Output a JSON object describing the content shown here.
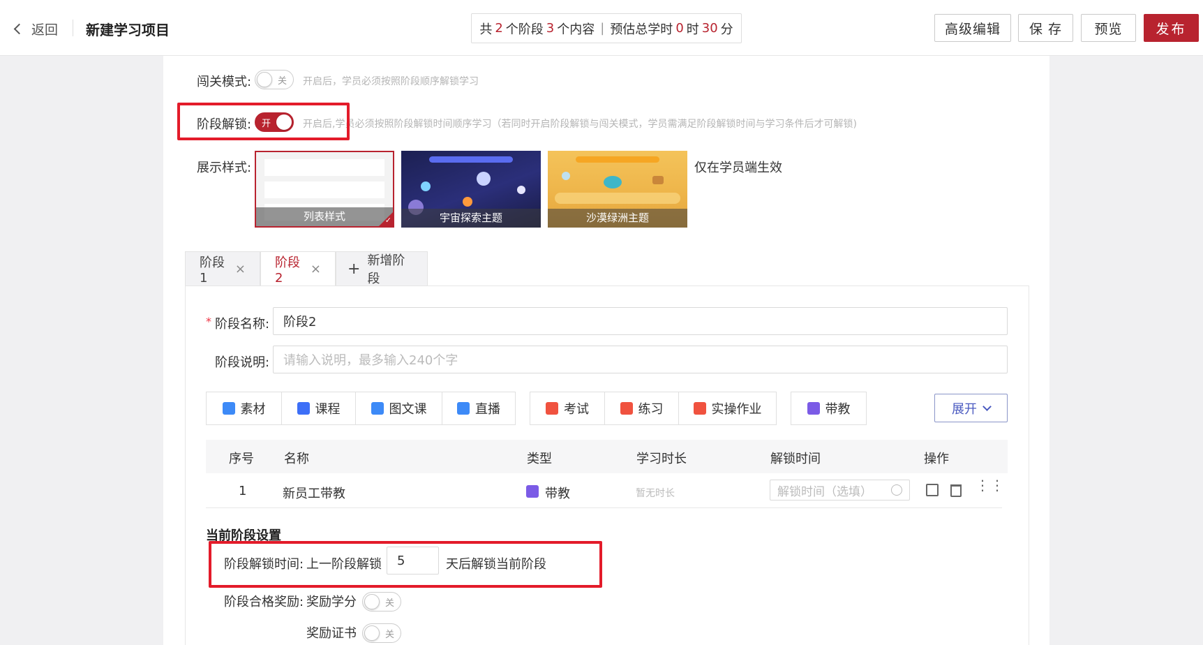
{
  "header": {
    "back_label": "返回",
    "title": "新建学习项目",
    "summary": {
      "prefix": "共",
      "stages": "2",
      "stages_unit": "个阶段",
      "contents": "3",
      "contents_unit": "个内容",
      "est_label": "预估总学时",
      "hours": "0",
      "hours_unit": "时",
      "minutes": "30",
      "minutes_unit": "分"
    },
    "buttons": {
      "advanced_edit": "高级编辑",
      "save": "保 存",
      "preview": "预览",
      "publish": "发布"
    }
  },
  "settings": {
    "gate_mode": {
      "label": "闯关模式:",
      "state": "关",
      "hint": "开启后，学员必须按照阶段顺序解锁学习"
    },
    "stage_unlock": {
      "label": "阶段解锁:",
      "state": "开",
      "hint": "开启后,学员必须按照阶段解锁时间顺序学习（若同时开启阶段解锁与闯关模式，学员需满足阶段解锁时间与学习条件后才可解锁)"
    },
    "display_style": {
      "label": "展示样式:",
      "note": "仅在学员端生效",
      "themes": [
        {
          "name": "列表样式",
          "selected": true
        },
        {
          "name": "宇宙探索主题",
          "selected": false
        },
        {
          "name": "沙漠绿洲主题",
          "selected": false
        }
      ]
    }
  },
  "tabs": [
    {
      "label": "阶段1",
      "close": "×"
    },
    {
      "label": "阶段2",
      "close": "×"
    }
  ],
  "add_stage": {
    "icon": "+",
    "label": "新增阶段"
  },
  "stage_form": {
    "required_mark": "*",
    "name_label": "阶段名称:",
    "name_value": "阶段2",
    "desc_label": "阶段说明:",
    "desc_placeholder": "请输入说明，最多输入240个字"
  },
  "content_types": {
    "group1": [
      "素材",
      "课程",
      "图文课",
      "直播"
    ],
    "group2": [
      "考试",
      "练习",
      "实操作业"
    ],
    "group3": [
      "带教"
    ],
    "expand_label": "展开"
  },
  "table": {
    "columns": [
      "序号",
      "名称",
      "类型",
      "学习时长",
      "解锁时间",
      "操作"
    ],
    "rows": [
      {
        "index": "1",
        "name": "新员工带教",
        "type": "带教",
        "duration": "暂无时长",
        "unlock_placeholder": "解锁时间（选填）"
      }
    ]
  },
  "current_stage": {
    "section_title": "当前阶段设置",
    "unlock_time_label": "阶段解锁时间:",
    "unlock_prefix": "上一阶段解锁",
    "unlock_days": "5",
    "unlock_suffix": "天后解锁当前阶段",
    "reward_label": "阶段合格奖励:",
    "reward_credits": {
      "label": "奖励学分",
      "state": "关"
    },
    "reward_cert": {
      "label": "奖励证书",
      "state": "关"
    }
  },
  "colors": {
    "brand": "#b8232f",
    "highlight": "#e31b2a",
    "link": "#4a5ac0"
  }
}
